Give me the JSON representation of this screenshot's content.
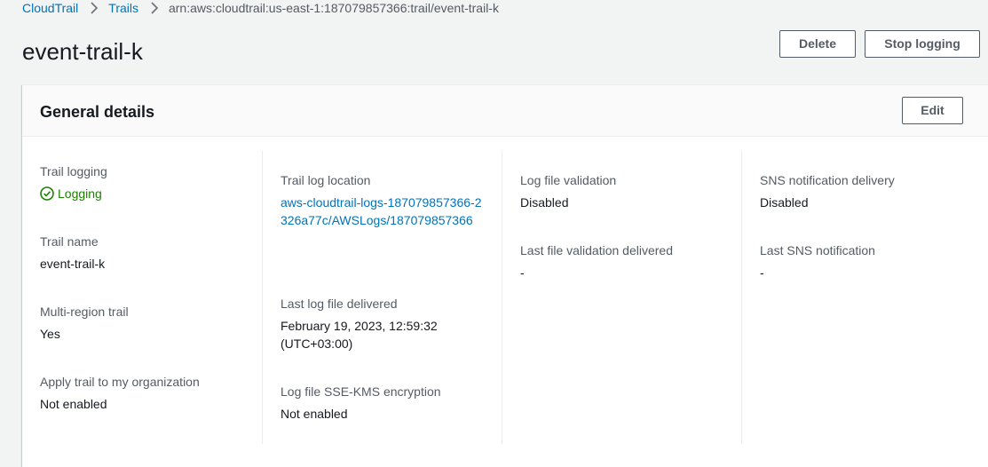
{
  "breadcrumb": {
    "items": [
      "CloudTrail",
      "Trails"
    ],
    "current": "arn:aws:cloudtrail:us-east-1:187079857366:trail/event-trail-k"
  },
  "page": {
    "title": "event-trail-k",
    "delete_label": "Delete",
    "stop_logging_label": "Stop logging"
  },
  "general": {
    "title": "General details",
    "edit_label": "Edit",
    "trail_logging": {
      "label": "Trail logging",
      "value": "Logging"
    },
    "trail_name": {
      "label": "Trail name",
      "value": "event-trail-k"
    },
    "multi_region": {
      "label": "Multi-region trail",
      "value": "Yes"
    },
    "apply_org": {
      "label": "Apply trail to my organization",
      "value": "Not enabled"
    },
    "log_location": {
      "label": "Trail log location",
      "value": "aws-cloudtrail-logs-187079857366-2326a77c/AWSLogs/187079857366"
    },
    "last_log": {
      "label": "Last log file delivered",
      "value_line1": "February 19, 2023, 12:59:32",
      "value_line2": "(UTC+03:00)"
    },
    "sse_kms": {
      "label": "Log file SSE-KMS encryption",
      "value": "Not enabled"
    },
    "log_validation": {
      "label": "Log file validation",
      "value": "Disabled"
    },
    "last_validation": {
      "label": "Last file validation delivered",
      "value": "-"
    },
    "sns_delivery": {
      "label": "SNS notification delivery",
      "value": "Disabled"
    },
    "last_sns": {
      "label": "Last SNS notification",
      "value": "-"
    }
  },
  "colors": {
    "link": "#0073bb",
    "success": "#1d8102",
    "text": "#16191f",
    "label": "#545b64"
  },
  "icons": {
    "breadcrumb_separator": "chevron-right-icon",
    "status": "check-circle-icon"
  }
}
